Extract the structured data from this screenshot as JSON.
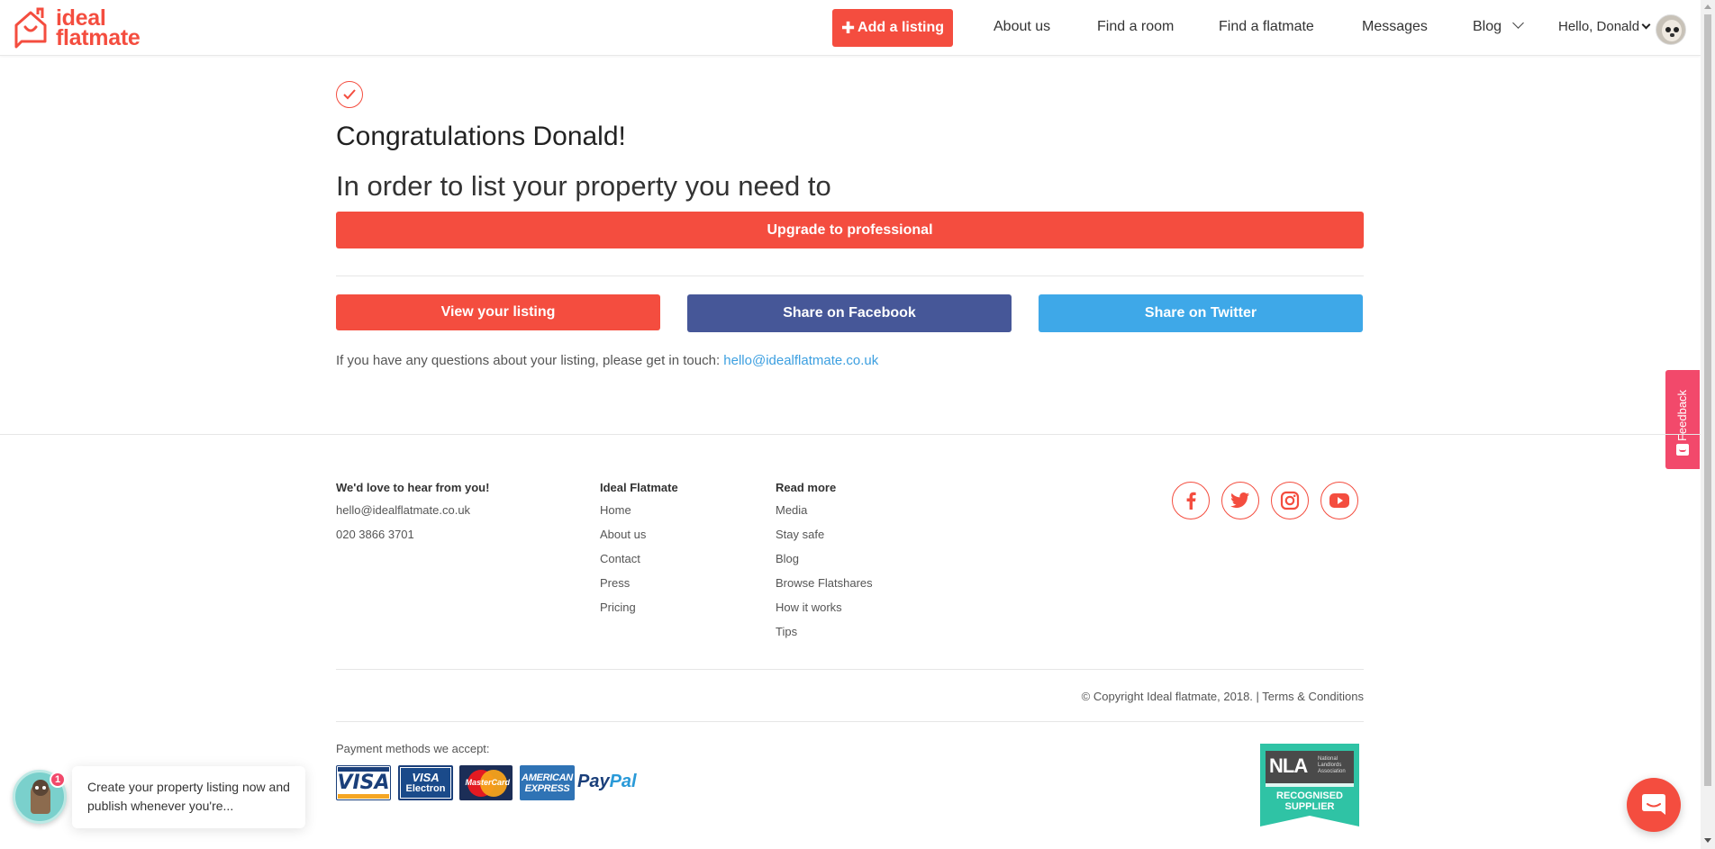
{
  "brand": {
    "line1": "ideal",
    "line2": "flatmate",
    "color": "#f44d3f"
  },
  "header": {
    "add_listing": "Add a listing",
    "nav": [
      "About us",
      "Find a room",
      "Find a flatmate",
      "Messages",
      "Blog"
    ],
    "greeting": "Hello, Donald"
  },
  "main": {
    "title": "Congratulations Donald!",
    "subtitle": "In order to list your property you need to",
    "upgrade_button": "Upgrade to professional",
    "view_listing_button": "View your listing",
    "facebook_button": "Share on Facebook",
    "twitter_button": "Share on Twitter",
    "contact_text": "If you have any questions about your listing, please get in touch: ",
    "contact_email": "hello@idealflatmate.co.uk"
  },
  "feedback_tab": "Feedback",
  "footer": {
    "contact": {
      "heading": "We'd love to hear from you!",
      "email": "hello@idealflatmate.co.uk",
      "phone": "020 3866 3701"
    },
    "ideal_flatmate": {
      "heading": "Ideal Flatmate",
      "links": [
        "Home",
        "About us",
        "Contact",
        "Press",
        "Pricing"
      ]
    },
    "read_more": {
      "heading": "Read more",
      "links": [
        "Media",
        "Stay safe",
        "Blog",
        "Browse Flatshares",
        "How it works",
        "Tips"
      ]
    },
    "social": [
      "facebook-icon",
      "twitter-icon",
      "instagram-icon",
      "youtube-icon"
    ],
    "copyright": "© Copyright Ideal flatmate, 2018. | Terms & Conditions",
    "payment_label": "Payment methods we accept:",
    "cards": {
      "visa": "VISA",
      "electron_top": "VISA",
      "electron_bottom": "Electron",
      "mastercard": "MasterCard",
      "amex_top": "AMERICAN",
      "amex_bottom": "EXPRESS",
      "paypal_a": "Pay",
      "paypal_b": "Pal"
    },
    "nla": {
      "short": "NLA",
      "full_1": "National",
      "full_2": "Landlords",
      "full_3": "Association",
      "badge_1": "RECOGNISED",
      "badge_2": "SUPPLIER"
    }
  },
  "chat": {
    "badge_count": "1",
    "message": "Create your property listing now and publish whenever you're..."
  }
}
